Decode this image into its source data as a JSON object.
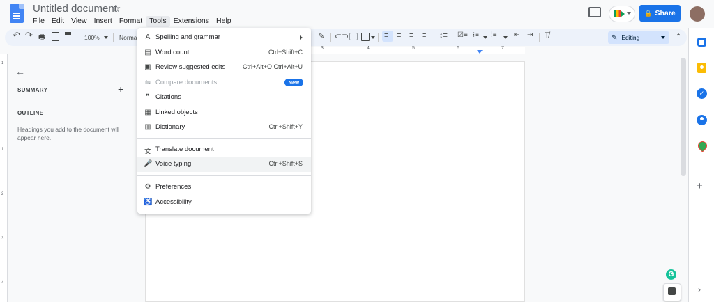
{
  "header": {
    "title": "Untitled document",
    "star": "☆",
    "menus": [
      "File",
      "Edit",
      "View",
      "Insert",
      "Format",
      "Tools",
      "Extensions",
      "Help"
    ],
    "share_label": "Share",
    "lock_glyph": "🔒"
  },
  "toolbar": {
    "undo": "↶",
    "redo": "↷",
    "print": "🖶",
    "zoom": "100%",
    "style": "Normal",
    "editing_label": "Editing",
    "editing_glyph": "✎",
    "collapse": "⌃"
  },
  "ruler": {
    "numbers": [
      "3",
      "4",
      "5",
      "6",
      "7"
    ]
  },
  "vruler": {
    "numbers": [
      "1",
      "1",
      "2",
      "3",
      "4"
    ]
  },
  "outline_panel": {
    "back": "←",
    "summary_label": "SUMMARY",
    "summary_add": "+",
    "outline_label": "OUTLINE",
    "hint": "Headings you add to the document will appear here."
  },
  "tools_menu": {
    "items": [
      {
        "icon": "A̱",
        "label": "Spelling and grammar",
        "shortcut": "",
        "submenu": true
      },
      {
        "icon": "▤",
        "label": "Word count",
        "shortcut": "Ctrl+Shift+C"
      },
      {
        "icon": "▣",
        "label": "Review suggested edits",
        "shortcut": "Ctrl+Alt+O Ctrl+Alt+U"
      },
      {
        "icon": "⇋",
        "label": "Compare documents",
        "shortcut": "",
        "badge": "New",
        "disabled": true
      },
      {
        "icon": "❞",
        "label": "Citations",
        "shortcut": ""
      },
      {
        "icon": "▦",
        "label": "Linked objects",
        "shortcut": ""
      },
      {
        "icon": "▥",
        "label": "Dictionary",
        "shortcut": "Ctrl+Shift+Y"
      },
      {
        "icon": "文",
        "label": "Translate document",
        "shortcut": ""
      },
      {
        "icon": "🎤",
        "label": "Voice typing",
        "shortcut": "Ctrl+Shift+S"
      },
      {
        "icon": "⚙",
        "label": "Preferences",
        "shortcut": ""
      },
      {
        "icon": "♿",
        "label": "Accessibility",
        "shortcut": ""
      }
    ]
  },
  "side": {
    "add": "+",
    "expand": "›",
    "grammarly": "G",
    "tasks_glyph": "✓"
  },
  "colors": {
    "accent": "#1a73e8",
    "toolbar_bg": "#edf2fa",
    "editing_bg": "#d3e3fd"
  }
}
